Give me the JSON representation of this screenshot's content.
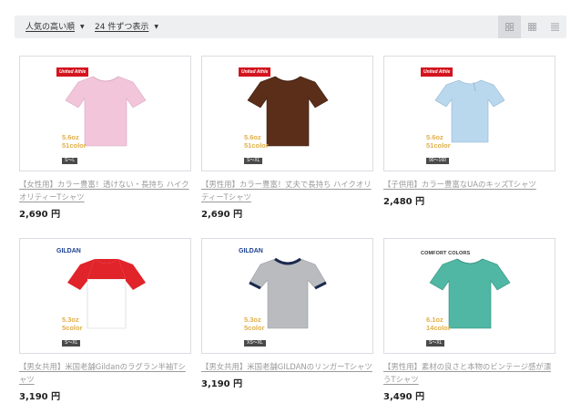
{
  "toolbar": {
    "sort_label": "人気の高い順",
    "count_label": "24 件ずつ表示",
    "views": [
      "grid-2-icon",
      "grid-3-icon",
      "list-icon"
    ]
  },
  "products": [
    {
      "title": "【女性用】カラー豊富！透けない・長持ち ハイクオリティーTシャツ",
      "price": "2,690 円",
      "brand": "United Athle",
      "weight": "5.6oz",
      "colors": "51color",
      "sizes": "S〜L",
      "shirt_color": "#f2c5da",
      "shirt_style": "tee"
    },
    {
      "title": "【男性用】カラー豊富！丈夫で長持ち ハイクオリティーTシャツ",
      "price": "2,690 円",
      "brand": "United Athle",
      "weight": "5.6oz",
      "colors": "51color",
      "sizes": "S〜XL",
      "shirt_color": "#5a2e18",
      "shirt_style": "tee"
    },
    {
      "title": "【子供用】カラー豊富なUAのキッズTシャツ",
      "price": "2,480 円",
      "brand": "United Athle",
      "weight": "5.6oz",
      "colors": "51color",
      "sizes": "90〜160",
      "shirt_color": "#b9d8ee",
      "shirt_style": "tee-kids"
    },
    {
      "title": "【男女共用】米国老舗Gildanのラグラン半袖Tシャツ",
      "price": "3,190 円",
      "brand": "GILDAN",
      "weight": "5.3oz",
      "colors": "5color",
      "sizes": "S〜XL",
      "shirt_color": "#ffffff",
      "accent_color": "#e0242a",
      "shirt_style": "raglan"
    },
    {
      "title": "【男女共用】米国老舗GILDANのリンガーTシャツ",
      "price": "3,190 円",
      "brand": "GILDAN",
      "weight": "5.3oz",
      "colors": "5color",
      "sizes": "XS〜XL",
      "shirt_color": "#b9bbbf",
      "accent_color": "#1a2a4e",
      "shirt_style": "ringer"
    },
    {
      "title": "【男性用】素材の良さと本物のビンテージ感が漂うTシャツ",
      "price": "3,490 円",
      "brand": "COMFORT COLORS",
      "weight": "6.1oz",
      "colors": "14color",
      "sizes": "S〜XL",
      "shirt_color": "#4fb7a3",
      "shirt_style": "tee"
    }
  ]
}
